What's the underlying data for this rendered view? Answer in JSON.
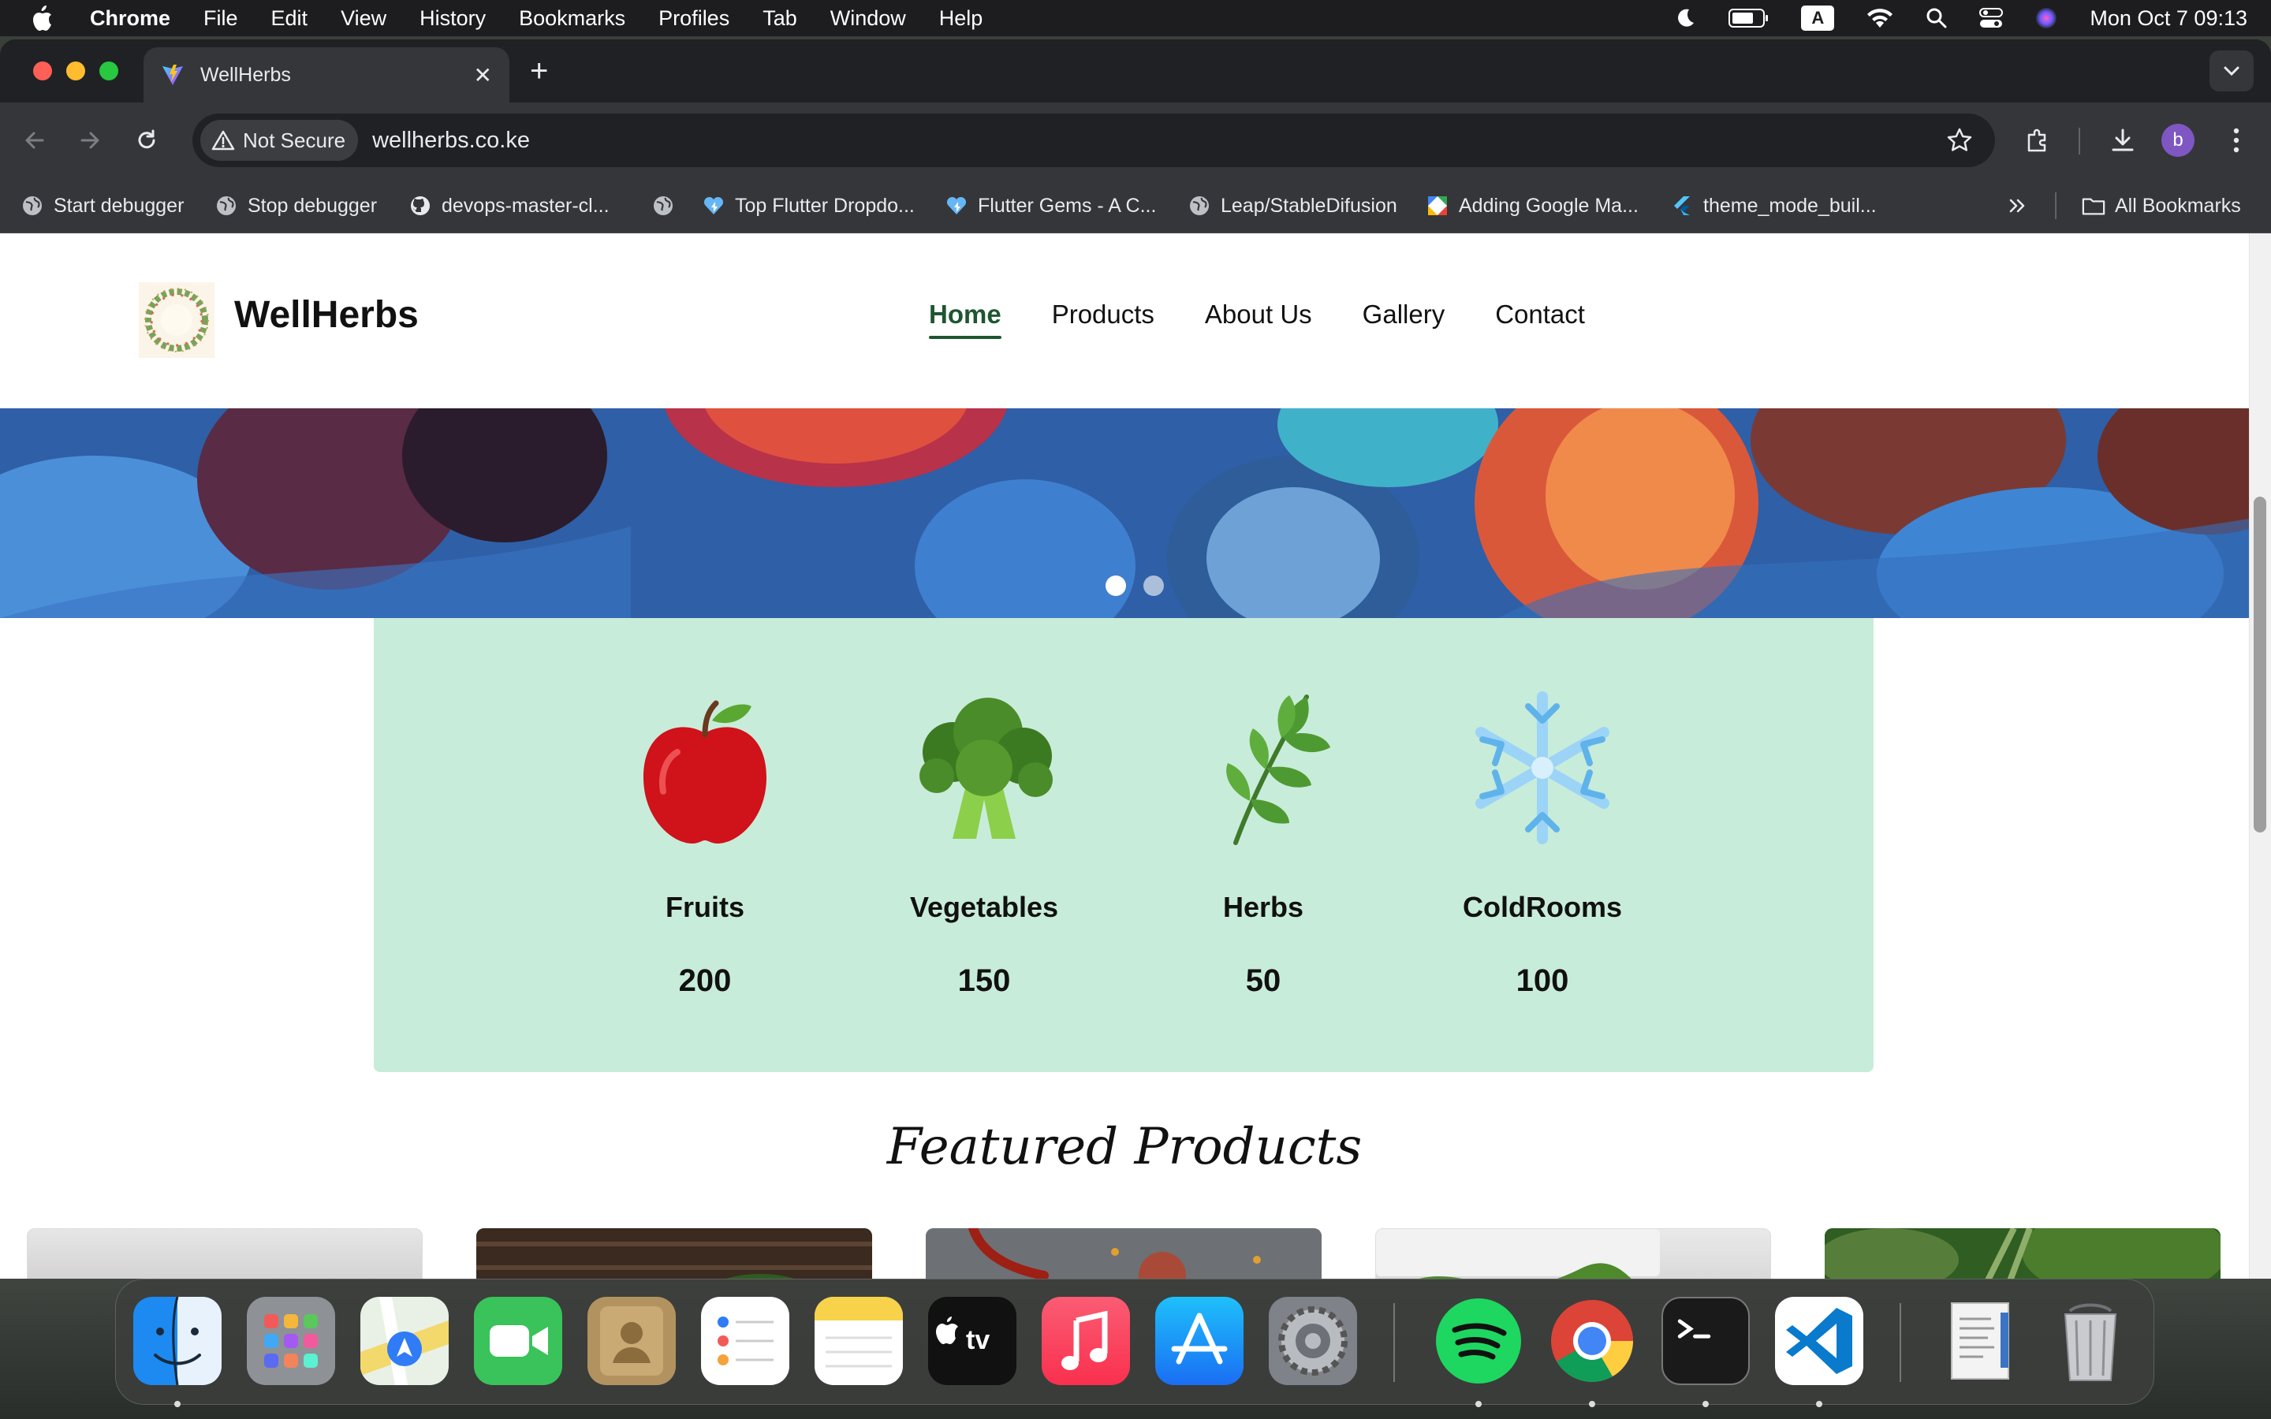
{
  "menubar": {
    "app_name": "Chrome",
    "items": [
      "File",
      "Edit",
      "View",
      "History",
      "Bookmarks",
      "Profiles",
      "Tab",
      "Window",
      "Help"
    ],
    "ime_indicator": "A",
    "clock": "Mon Oct 7  09:13"
  },
  "browser": {
    "tab_title": "WellHerbs",
    "security_label": "Not Secure",
    "url": "wellherbs.co.ke",
    "profile_initial": "b",
    "bookmarks": [
      "Start debugger",
      "Stop debugger",
      "devops-master-cl...",
      "",
      "Top Flutter Dropdo...",
      "Flutter Gems - A C...",
      "Leap/StableDifusion",
      "Adding Google Ma...",
      "theme_mode_buil..."
    ],
    "all_bookmarks_label": "All Bookmarks"
  },
  "site": {
    "brand": "WellHerbs",
    "nav": [
      "Home",
      "Products",
      "About Us",
      "Gallery",
      "Contact"
    ],
    "active_nav": "Home",
    "carousel": {
      "slides": 2,
      "active_slide": 1
    },
    "stats": [
      {
        "label": "Fruits",
        "value": "200",
        "icon": "apple-icon"
      },
      {
        "label": "Vegetables",
        "value": "150",
        "icon": "broccoli-icon"
      },
      {
        "label": "Herbs",
        "value": "50",
        "icon": "herb-icon"
      },
      {
        "label": "ColdRooms",
        "value": "100",
        "icon": "snowflake-icon"
      }
    ],
    "featured_title": "Featured Products"
  },
  "colors": {
    "accent": "#1e5631",
    "stats_panel": "#c8ecda",
    "chrome_dark": "#202124",
    "chrome_toolbar": "#35363a"
  },
  "dock": {
    "apps": [
      "Finder",
      "Launchpad",
      "Maps",
      "FaceTime",
      "Contacts",
      "Reminders",
      "Notes",
      "Apple TV",
      "Music",
      "App Store",
      "System Settings",
      "Spotify",
      "Google Chrome",
      "Terminal",
      "Visual Studio Code",
      "Document",
      "Trash"
    ]
  }
}
